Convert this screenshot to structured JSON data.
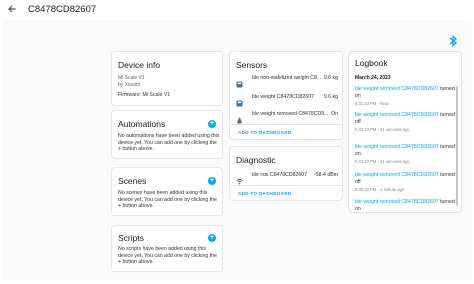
{
  "header": {
    "title": "C8478CD82607"
  },
  "device_info": {
    "title": "Device info",
    "model": "Mi Scale V1",
    "manufacturer": "by Xiaomi",
    "firmware": "Firmware: Mi Scale V1"
  },
  "automations": {
    "title": "Automations",
    "empty_text": "No automations have been added using this device yet. You can add one by clicking the + button above."
  },
  "scenes": {
    "title": "Scenes",
    "empty_text": "No scenes have been added using this device yet. You can add one by clicking the + button above."
  },
  "scripts": {
    "title": "Scripts",
    "empty_text": "No scripts have been added using this device yet. You can add one by clicking the + button above."
  },
  "sensors": {
    "title": "Sensors",
    "rows": [
      {
        "label": "ble non-stabilized weight C8...",
        "value": "9.6 kg",
        "icon": "scale-icon"
      },
      {
        "label": "ble weight C8478CD82607",
        "value": "9.6 kg",
        "icon": "scale-icon"
      },
      {
        "label": "ble weight removed C8478CD8...",
        "value": "On",
        "icon": "weight-icon"
      }
    ],
    "add_link": "ADD TO DASHBOARD"
  },
  "diagnostic": {
    "title": "Diagnostic",
    "rows": [
      {
        "label": "ble rssi C8478CD82607",
        "value": "-58.4 dBm",
        "icon": "wifi-icon"
      }
    ],
    "add_link": "ADD TO DASHBOARD"
  },
  "logbook": {
    "title": "Logbook",
    "date": "March 24, 2023",
    "entries": [
      {
        "entity": "ble weight removed C8478CD82607",
        "action": " turned on",
        "time": "6:31:33 PM - Now"
      },
      {
        "entity": "ble weight removed C8478CD82607",
        "action": " turned off",
        "time": "6:31:13 PM - 21 seconds ago"
      },
      {
        "entity": "ble weight removed C8478CD82607",
        "action": " turned on",
        "time": "6:31:12 PM - 21 seconds ago"
      },
      {
        "entity": "ble weight removed C8478CD82607",
        "action": " turned off",
        "time": "6:30:42 PM - 1 minute ago"
      },
      {
        "entity": "ble weight removed C8478CD82607",
        "action": " turned on",
        "time": ""
      }
    ]
  },
  "colors": {
    "accent": "#03a9f4",
    "icon": "#44739e"
  }
}
